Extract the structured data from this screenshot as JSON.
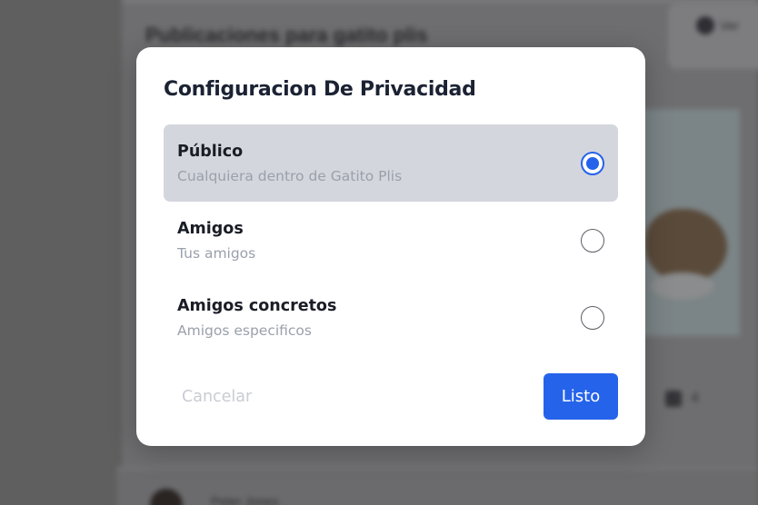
{
  "background": {
    "section_title": "Publicaciones para gatito plis",
    "action_text": "Ver",
    "like_count": "4",
    "author_name": "Peter Jones"
  },
  "modal": {
    "title": "Configuracion De Privacidad",
    "options": [
      {
        "label": "Público",
        "description": "Cualquiera dentro de Gatito Plis",
        "selected": true
      },
      {
        "label": "Amigos",
        "description": "Tus amigos",
        "selected": false
      },
      {
        "label": "Amigos concretos",
        "description": "Amigos especificos",
        "selected": false
      }
    ],
    "cancel_label": "Cancelar",
    "done_label": "Listo"
  },
  "colors": {
    "accent": "#2563eb",
    "selected_row": "#d3d6dd",
    "title_text": "#1b2233",
    "muted_text": "#9aa0ab"
  }
}
